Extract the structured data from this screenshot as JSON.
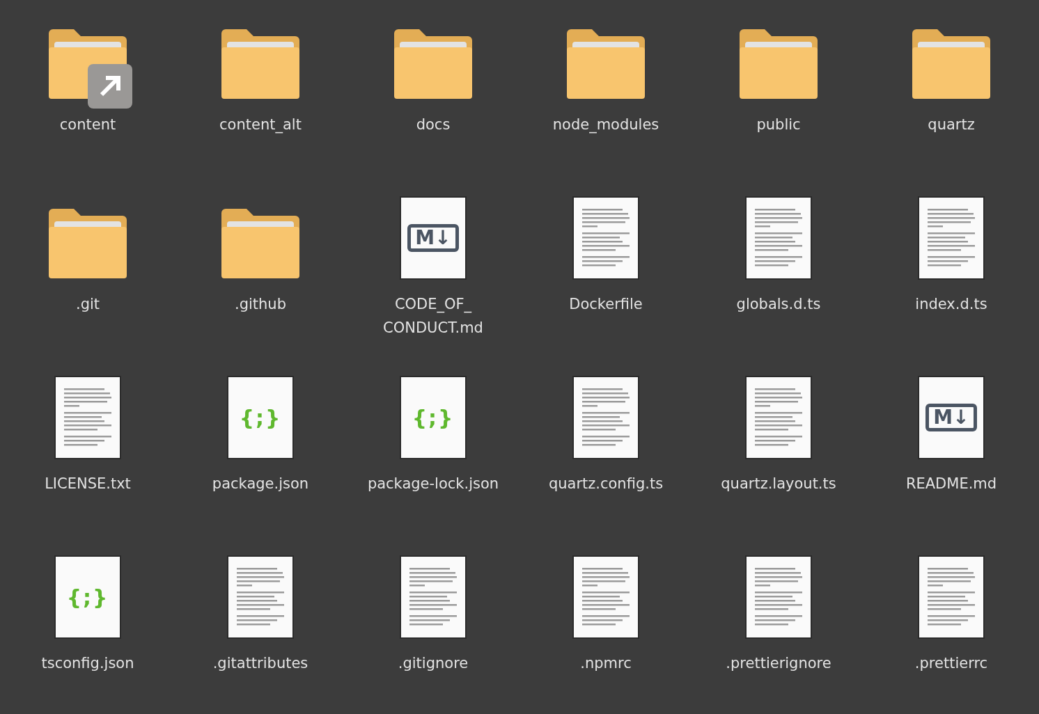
{
  "files": [
    {
      "kind": "folder",
      "label": "content",
      "link": true
    },
    {
      "kind": "folder",
      "label": "content_alt",
      "link": false
    },
    {
      "kind": "folder",
      "label": "docs",
      "link": false
    },
    {
      "kind": "folder",
      "label": "node_modules",
      "link": false
    },
    {
      "kind": "folder",
      "label": "public",
      "link": false
    },
    {
      "kind": "folder",
      "label": "quartz",
      "link": false
    },
    {
      "kind": "folder",
      "label": ".git",
      "link": false
    },
    {
      "kind": "folder",
      "label": ".github",
      "link": false
    },
    {
      "kind": "markdown",
      "label": "CODE_OF_\nCONDUCT.md",
      "glyph": "M↓"
    },
    {
      "kind": "text",
      "label": "Dockerfile"
    },
    {
      "kind": "text",
      "label": "globals.d.ts"
    },
    {
      "kind": "text",
      "label": "index.d.ts"
    },
    {
      "kind": "text",
      "label": "LICENSE.txt"
    },
    {
      "kind": "json",
      "label": "package.json",
      "glyph": "{;}"
    },
    {
      "kind": "json",
      "label": "package-lock.json",
      "glyph": "{;}"
    },
    {
      "kind": "text",
      "label": "quartz.config.ts"
    },
    {
      "kind": "text",
      "label": "quartz.layout.ts"
    },
    {
      "kind": "markdown",
      "label": "README.md",
      "glyph": "M↓"
    },
    {
      "kind": "json",
      "label": "tsconfig.json",
      "glyph": "{;}"
    },
    {
      "kind": "text",
      "label": ".gitattributes"
    },
    {
      "kind": "text",
      "label": ".gitignore"
    },
    {
      "kind": "text",
      "label": ".npmrc"
    },
    {
      "kind": "text",
      "label": ".prettierignore"
    },
    {
      "kind": "text",
      "label": ".prettierrc"
    }
  ]
}
